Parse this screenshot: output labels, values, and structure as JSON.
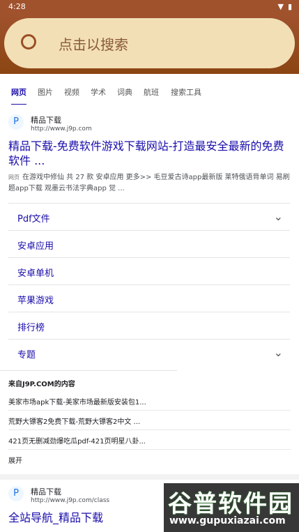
{
  "status": {
    "time": "4:28"
  },
  "search": {
    "placeholder": "点击以搜索"
  },
  "tabs": [
    "网页",
    "图片",
    "视频",
    "学术",
    "词典",
    "航班",
    "搜索工具"
  ],
  "result1": {
    "logo": "P",
    "site_name": "精品下载",
    "site_url": "http://www.j9p.com",
    "title": "精品下载-免费软件游戏下载网站-打造最安全最新的免费软件 ...",
    "snippet_tag": "网页",
    "snippet": "在游戏中修仙 共 27 款 安卓应用 更多>> 毛豆爱古诗app最新版 莱特俄语背单词 易刷题app下载 观墨云书法字典app 觉 ...",
    "sublinks": [
      {
        "label": "Pdf文件",
        "chev": "⌄"
      },
      {
        "label": "安卓应用",
        "chev": ""
      },
      {
        "label": "安卓单机",
        "chev": ""
      },
      {
        "label": "苹果游戏",
        "chev": ""
      },
      {
        "label": "排行榜",
        "chev": ""
      },
      {
        "label": "专题",
        "chev": "⌄"
      }
    ],
    "from_title": "来自J9P.COM的内容",
    "from_items": [
      "美家市场apk下载-美家市场最新版安装包1...",
      "荒野大镖客2免费下载-荒野大镖客2中文 ...",
      "421页无删减劲爆吃瓜pdf-421页明星八卦...",
      "展开"
    ]
  },
  "result2": {
    "logo": "P",
    "site_name": "精品下载",
    "site_url": "http://www.j9p.com/class",
    "title": "全站导航_精品下载"
  },
  "watermark": {
    "line1": "谷普软件园",
    "line2": "www.gupuxiazai.com"
  }
}
